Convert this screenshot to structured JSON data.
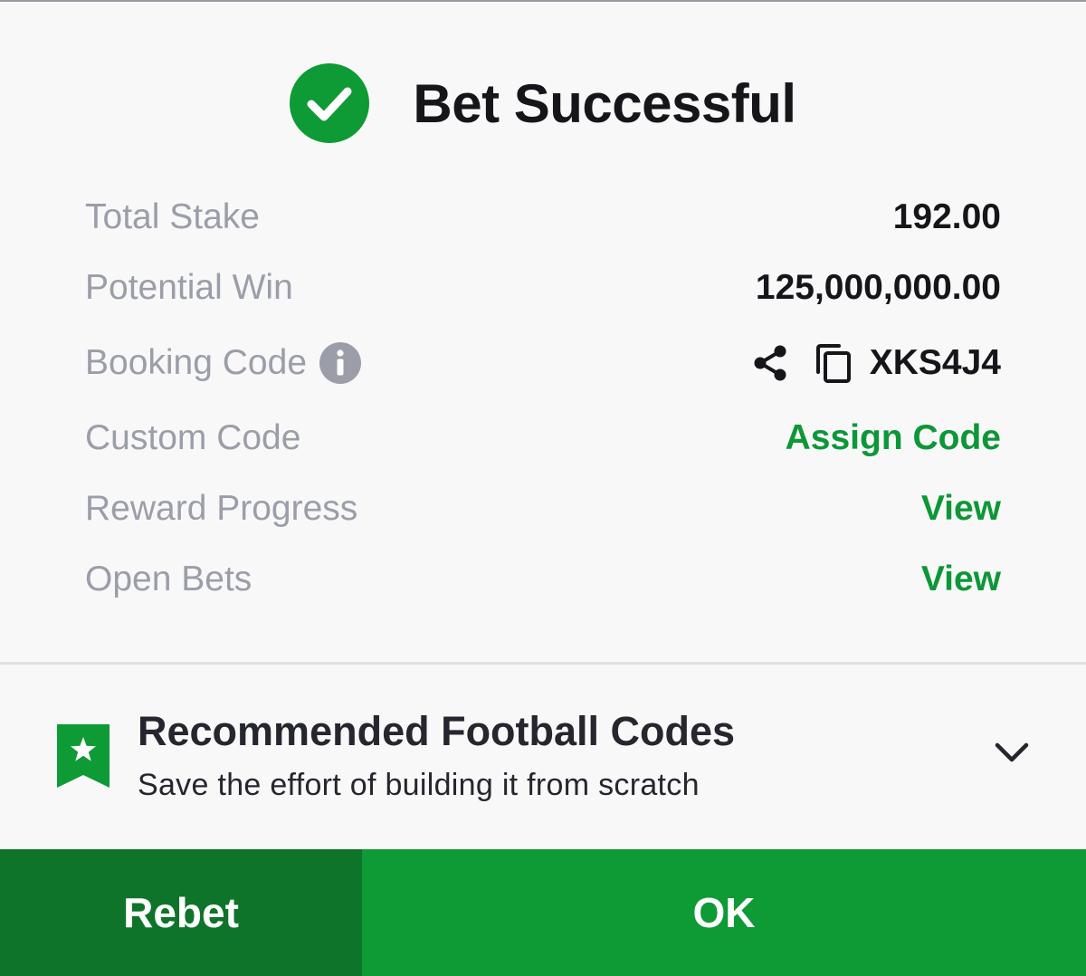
{
  "header": {
    "title": "Bet Successful",
    "status_icon": "check-circle-icon"
  },
  "details": {
    "total_stake": {
      "label": "Total Stake",
      "value": "192.00"
    },
    "potential_win": {
      "label": "Potential Win",
      "value": "125,000,000.00"
    },
    "booking_code": {
      "label": "Booking Code",
      "value": "XKS4J4",
      "icons": [
        "info-icon",
        "share-icon",
        "copy-icon"
      ]
    },
    "custom_code": {
      "label": "Custom Code",
      "link": "Assign Code"
    },
    "reward_progress": {
      "label": "Reward Progress",
      "link": "View"
    },
    "open_bets": {
      "label": "Open Bets",
      "link": "View"
    }
  },
  "recommended": {
    "title": "Recommended Football Codes",
    "subtitle": "Save the effort of building it from scratch",
    "icon": "star-ribbon-icon",
    "toggle_icon": "chevron-down-icon"
  },
  "buttons": {
    "rebet": "Rebet",
    "ok": "OK"
  },
  "colors": {
    "accent_green": "#0d9737",
    "ok_button": "#0e9a35",
    "rebet_button": "#0e7429",
    "label_gray": "#9b9ea8",
    "text_dark": "#16161a",
    "background": "#f8f8f9"
  }
}
